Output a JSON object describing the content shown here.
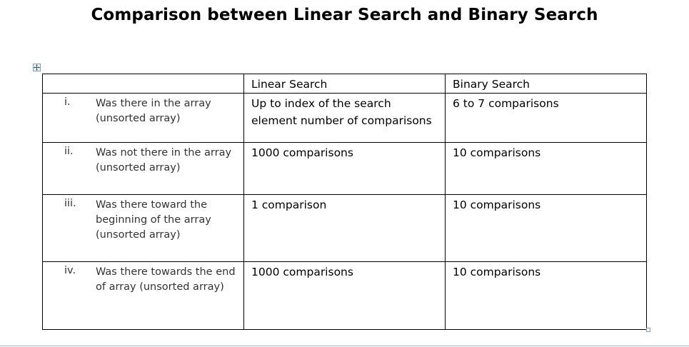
{
  "title": "Comparison between Linear Search and Binary Search",
  "table": {
    "headers": [
      "",
      "Linear Search",
      "Binary Search"
    ],
    "rows": [
      {
        "num": "i.",
        "desc": "Was there in the array (unsorted array)",
        "linear": "Up to index of the search element number of comparisons",
        "binary": "6 to 7 comparisons"
      },
      {
        "num": "ii.",
        "desc": "Was not there in the array (unsorted array)",
        "linear": "1000 comparisons",
        "binary": "10 comparisons"
      },
      {
        "num": "iii.",
        "desc": "Was there toward the beginning of the array (unsorted array)",
        "linear": "1 comparison",
        "binary": "10 comparisons"
      },
      {
        "num": "iv.",
        "desc": "Was there towards the end of array (unsorted array)",
        "linear": "1000 comparisons",
        "binary": "10 comparisons"
      }
    ]
  },
  "icons": {
    "move": "table-move-handle-icon",
    "resize": "table-resize-handle-icon"
  }
}
